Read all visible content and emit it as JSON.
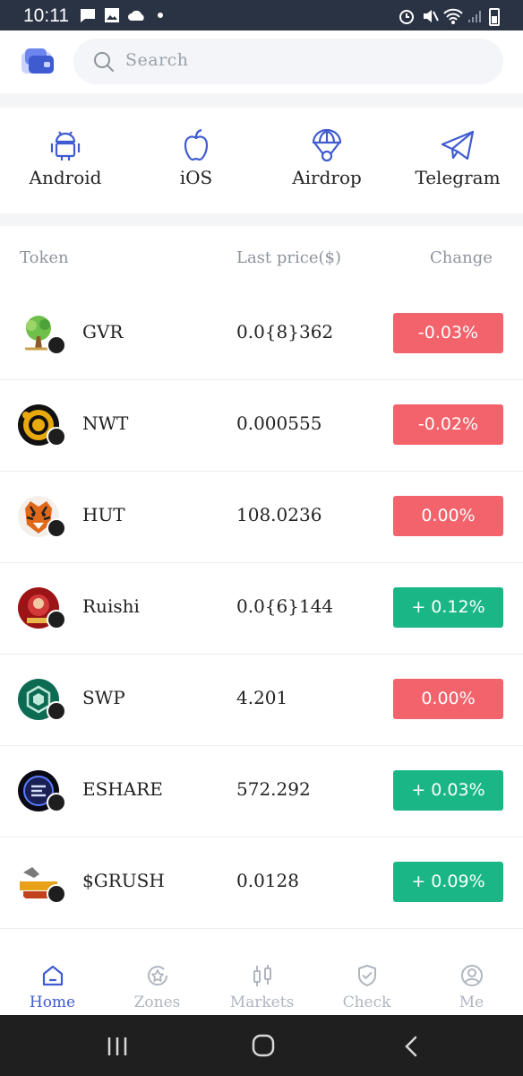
{
  "status_bar": {
    "time": "10:11"
  },
  "search": {
    "placeholder": "Search"
  },
  "quick_links": [
    {
      "label": "Android",
      "icon": "android-icon"
    },
    {
      "label": "iOS",
      "icon": "apple-icon"
    },
    {
      "label": "Airdrop",
      "icon": "parachute-icon"
    },
    {
      "label": "Telegram",
      "icon": "telegram-icon"
    }
  ],
  "table": {
    "headers": {
      "token": "Token",
      "price": "Last price($)",
      "change": "Change"
    },
    "rows": [
      {
        "name": "GVR",
        "price": "0.0{8}362",
        "change": "-0.03%",
        "direction": "down"
      },
      {
        "name": "NWT",
        "price": "0.000555",
        "change": "-0.02%",
        "direction": "down"
      },
      {
        "name": "HUT",
        "price": "108.0236",
        "change": "0.00%",
        "direction": "flat"
      },
      {
        "name": "Ruishi",
        "price": "0.0{6}144",
        "change": "+ 0.12%",
        "direction": "up"
      },
      {
        "name": "SWP",
        "price": "4.201",
        "change": "0.00%",
        "direction": "flat"
      },
      {
        "name": "ESHARE",
        "price": "572.292",
        "change": "+ 0.03%",
        "direction": "up"
      },
      {
        "name": "$GRUSH",
        "price": "0.0128",
        "change": "+ 0.09%",
        "direction": "up"
      }
    ]
  },
  "bottom_nav": [
    {
      "label": "Home",
      "icon": "home-icon",
      "active": true
    },
    {
      "label": "Zones",
      "icon": "zones-icon",
      "active": false
    },
    {
      "label": "Markets",
      "icon": "markets-icon",
      "active": false
    },
    {
      "label": "Check",
      "icon": "shield-check-icon",
      "active": false
    },
    {
      "label": "Me",
      "icon": "user-icon",
      "active": false
    }
  ],
  "colors": {
    "accent": "#3f5bd0",
    "down": "#f2636b",
    "up": "#1bb686",
    "inactive": "#b0b6bf",
    "status_bar": "#2a3344"
  }
}
